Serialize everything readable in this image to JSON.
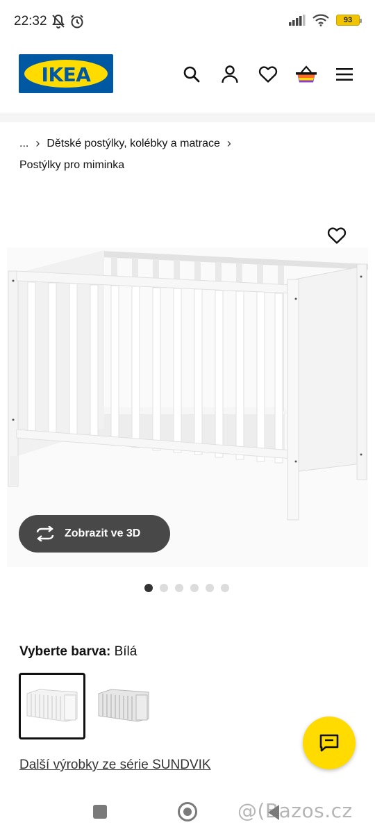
{
  "status_bar": {
    "time": "22:32",
    "battery": "93"
  },
  "header": {
    "logo_text": "IKEA",
    "brand_blue": "#0058a3",
    "brand_yellow": "#ffdb00"
  },
  "breadcrumb": {
    "ellipsis": "...",
    "category": "Dětské postýlky, kolébky a matrace",
    "current": "Postýlky pro miminka"
  },
  "product": {
    "view_3d_label": "Zobrazit ve 3D",
    "image_count": 6,
    "active_image": 1
  },
  "color_picker": {
    "label": "Vyberte barva:",
    "value": "Bílá"
  },
  "series_link": "Další výrobky ze série SUNDVIK",
  "watermark": "@(Bazos.cz"
}
